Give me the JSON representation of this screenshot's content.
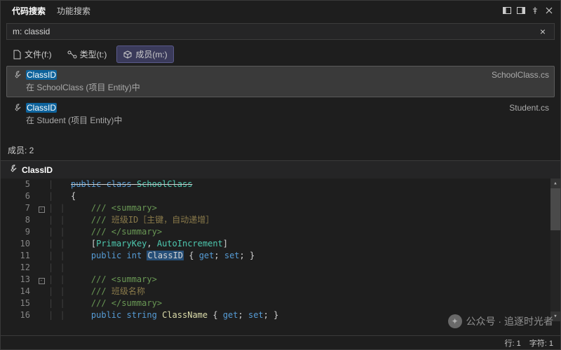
{
  "titlebar": {
    "tabs": [
      {
        "label": "代码搜索",
        "active": true
      },
      {
        "label": "功能搜索",
        "active": false
      }
    ]
  },
  "search": {
    "value": "m: classid"
  },
  "filters": [
    {
      "icon": "file-icon",
      "label": "文件(f:)",
      "active": false
    },
    {
      "icon": "type-icon",
      "label": "类型(t:)",
      "active": false
    },
    {
      "icon": "cube-icon",
      "label": "成员(m:)",
      "active": true
    }
  ],
  "results": [
    {
      "name": "ClassID",
      "hl_start": 0,
      "hl_end": 7,
      "file": "SchoolClass.cs",
      "context": "在 SchoolClass (项目 Entity)中",
      "selected": true
    },
    {
      "name": "ClassID",
      "hl_start": 0,
      "hl_end": 7,
      "file": "Student.cs",
      "context": "在 Student (项目 Entity)中",
      "selected": false
    }
  ],
  "members_label": "成员: 2",
  "preview": {
    "title": "ClassID",
    "lines": [
      {
        "n": 5,
        "fold": "",
        "guide": "|",
        "html": "<span class='tok-kw'>public</span> <span class='tok-kw'>class</span> <span class='tok-attr'>SchoolClass</span>",
        "strike": true
      },
      {
        "n": 6,
        "fold": "",
        "guide": "|",
        "html": "<span class='tok-punct'>{</span>"
      },
      {
        "n": 7,
        "fold": "box",
        "guide": "| |",
        "html": "    <span class='tok-comment'>/// &lt;summary&gt;</span>"
      },
      {
        "n": 8,
        "fold": "",
        "guide": "| |",
        "html": "    <span class='tok-comment'>///</span> <span class='tok-comment-cn'>班级ID［主键，自动递增］</span>"
      },
      {
        "n": 9,
        "fold": "",
        "guide": "| |",
        "html": "    <span class='tok-comment'>/// &lt;/summary&gt;</span>"
      },
      {
        "n": 10,
        "fold": "",
        "guide": "| |",
        "html": "    <span class='tok-punct'>[</span><span class='tok-attr'>PrimaryKey</span><span class='tok-punct'>,</span> <span class='tok-attr'>AutoIncrement</span><span class='tok-punct'>]</span>"
      },
      {
        "n": 11,
        "fold": "",
        "guide": "| |",
        "html": "    <span class='tok-kw'>public</span> <span class='tok-type'>int</span> <span class='tok-member-hl'>ClassID</span> <span class='tok-punct'>{</span> <span class='tok-kw'>get</span><span class='tok-punct'>;</span> <span class='tok-kw'>set</span><span class='tok-punct'>;</span> <span class='tok-punct'>}</span>"
      },
      {
        "n": 12,
        "fold": "",
        "guide": "| |",
        "html": ""
      },
      {
        "n": 13,
        "fold": "box",
        "guide": "| |",
        "html": "    <span class='tok-comment'>/// &lt;summary&gt;</span>"
      },
      {
        "n": 14,
        "fold": "",
        "guide": "| |",
        "html": "    <span class='tok-comment'>///</span> <span class='tok-comment-cn'>班级名称</span>"
      },
      {
        "n": 15,
        "fold": "",
        "guide": "| |",
        "html": "    <span class='tok-comment'>/// &lt;/summary&gt;</span>"
      },
      {
        "n": 16,
        "fold": "",
        "guide": "| |",
        "html": "    <span class='tok-kw'>public</span> <span class='tok-type'>string</span> <span class='tok-member'>ClassName</span> <span class='tok-punct'>{</span> <span class='tok-kw'>get</span><span class='tok-punct'>;</span> <span class='tok-kw'>set</span><span class='tok-punct'>;</span> <span class='tok-punct'>}</span>"
      }
    ]
  },
  "status": {
    "line": "行: 1",
    "char": "字符: 1"
  },
  "watermark": {
    "text": "公众号 · 追逐时光者"
  }
}
